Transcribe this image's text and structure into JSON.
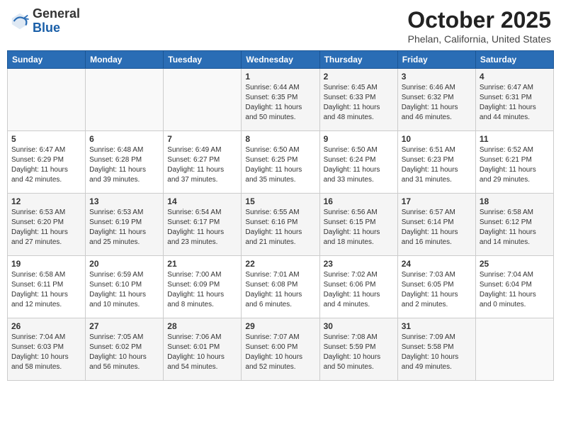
{
  "header": {
    "logo_general": "General",
    "logo_blue": "Blue",
    "month_title": "October 2025",
    "location": "Phelan, California, United States"
  },
  "weekdays": [
    "Sunday",
    "Monday",
    "Tuesday",
    "Wednesday",
    "Thursday",
    "Friday",
    "Saturday"
  ],
  "weeks": [
    [
      {
        "day": "",
        "info": ""
      },
      {
        "day": "",
        "info": ""
      },
      {
        "day": "",
        "info": ""
      },
      {
        "day": "1",
        "info": "Sunrise: 6:44 AM\nSunset: 6:35 PM\nDaylight: 11 hours\nand 50 minutes."
      },
      {
        "day": "2",
        "info": "Sunrise: 6:45 AM\nSunset: 6:33 PM\nDaylight: 11 hours\nand 48 minutes."
      },
      {
        "day": "3",
        "info": "Sunrise: 6:46 AM\nSunset: 6:32 PM\nDaylight: 11 hours\nand 46 minutes."
      },
      {
        "day": "4",
        "info": "Sunrise: 6:47 AM\nSunset: 6:31 PM\nDaylight: 11 hours\nand 44 minutes."
      }
    ],
    [
      {
        "day": "5",
        "info": "Sunrise: 6:47 AM\nSunset: 6:29 PM\nDaylight: 11 hours\nand 42 minutes."
      },
      {
        "day": "6",
        "info": "Sunrise: 6:48 AM\nSunset: 6:28 PM\nDaylight: 11 hours\nand 39 minutes."
      },
      {
        "day": "7",
        "info": "Sunrise: 6:49 AM\nSunset: 6:27 PM\nDaylight: 11 hours\nand 37 minutes."
      },
      {
        "day": "8",
        "info": "Sunrise: 6:50 AM\nSunset: 6:25 PM\nDaylight: 11 hours\nand 35 minutes."
      },
      {
        "day": "9",
        "info": "Sunrise: 6:50 AM\nSunset: 6:24 PM\nDaylight: 11 hours\nand 33 minutes."
      },
      {
        "day": "10",
        "info": "Sunrise: 6:51 AM\nSunset: 6:23 PM\nDaylight: 11 hours\nand 31 minutes."
      },
      {
        "day": "11",
        "info": "Sunrise: 6:52 AM\nSunset: 6:21 PM\nDaylight: 11 hours\nand 29 minutes."
      }
    ],
    [
      {
        "day": "12",
        "info": "Sunrise: 6:53 AM\nSunset: 6:20 PM\nDaylight: 11 hours\nand 27 minutes."
      },
      {
        "day": "13",
        "info": "Sunrise: 6:53 AM\nSunset: 6:19 PM\nDaylight: 11 hours\nand 25 minutes."
      },
      {
        "day": "14",
        "info": "Sunrise: 6:54 AM\nSunset: 6:17 PM\nDaylight: 11 hours\nand 23 minutes."
      },
      {
        "day": "15",
        "info": "Sunrise: 6:55 AM\nSunset: 6:16 PM\nDaylight: 11 hours\nand 21 minutes."
      },
      {
        "day": "16",
        "info": "Sunrise: 6:56 AM\nSunset: 6:15 PM\nDaylight: 11 hours\nand 18 minutes."
      },
      {
        "day": "17",
        "info": "Sunrise: 6:57 AM\nSunset: 6:14 PM\nDaylight: 11 hours\nand 16 minutes."
      },
      {
        "day": "18",
        "info": "Sunrise: 6:58 AM\nSunset: 6:12 PM\nDaylight: 11 hours\nand 14 minutes."
      }
    ],
    [
      {
        "day": "19",
        "info": "Sunrise: 6:58 AM\nSunset: 6:11 PM\nDaylight: 11 hours\nand 12 minutes."
      },
      {
        "day": "20",
        "info": "Sunrise: 6:59 AM\nSunset: 6:10 PM\nDaylight: 11 hours\nand 10 minutes."
      },
      {
        "day": "21",
        "info": "Sunrise: 7:00 AM\nSunset: 6:09 PM\nDaylight: 11 hours\nand 8 minutes."
      },
      {
        "day": "22",
        "info": "Sunrise: 7:01 AM\nSunset: 6:08 PM\nDaylight: 11 hours\nand 6 minutes."
      },
      {
        "day": "23",
        "info": "Sunrise: 7:02 AM\nSunset: 6:06 PM\nDaylight: 11 hours\nand 4 minutes."
      },
      {
        "day": "24",
        "info": "Sunrise: 7:03 AM\nSunset: 6:05 PM\nDaylight: 11 hours\nand 2 minutes."
      },
      {
        "day": "25",
        "info": "Sunrise: 7:04 AM\nSunset: 6:04 PM\nDaylight: 11 hours\nand 0 minutes."
      }
    ],
    [
      {
        "day": "26",
        "info": "Sunrise: 7:04 AM\nSunset: 6:03 PM\nDaylight: 10 hours\nand 58 minutes."
      },
      {
        "day": "27",
        "info": "Sunrise: 7:05 AM\nSunset: 6:02 PM\nDaylight: 10 hours\nand 56 minutes."
      },
      {
        "day": "28",
        "info": "Sunrise: 7:06 AM\nSunset: 6:01 PM\nDaylight: 10 hours\nand 54 minutes."
      },
      {
        "day": "29",
        "info": "Sunrise: 7:07 AM\nSunset: 6:00 PM\nDaylight: 10 hours\nand 52 minutes."
      },
      {
        "day": "30",
        "info": "Sunrise: 7:08 AM\nSunset: 5:59 PM\nDaylight: 10 hours\nand 50 minutes."
      },
      {
        "day": "31",
        "info": "Sunrise: 7:09 AM\nSunset: 5:58 PM\nDaylight: 10 hours\nand 49 minutes."
      },
      {
        "day": "",
        "info": ""
      }
    ]
  ]
}
